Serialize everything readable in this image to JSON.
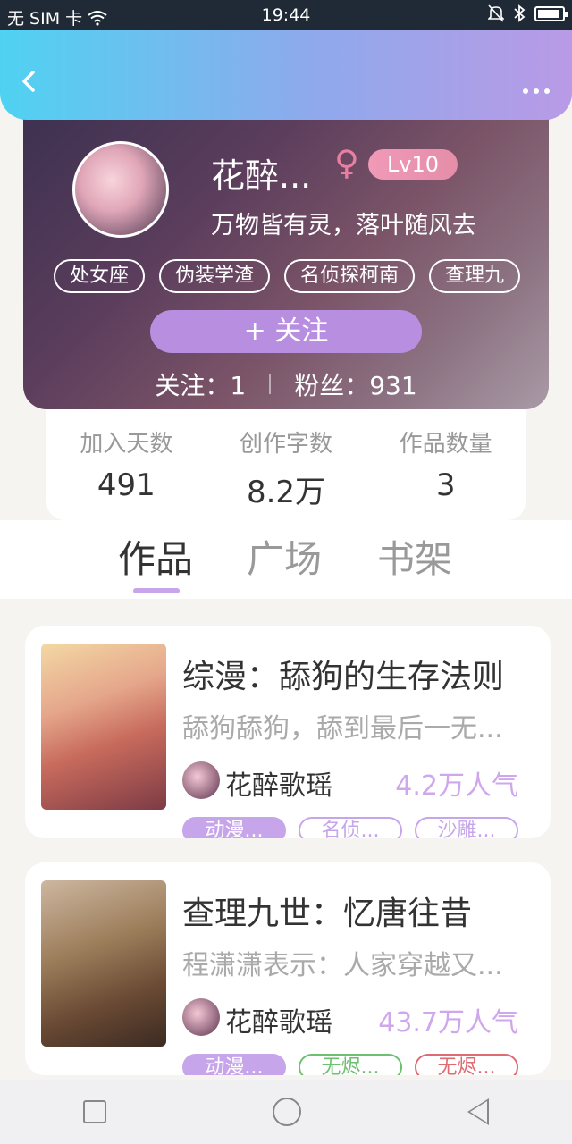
{
  "status_bar": {
    "carrier": "无 SIM 卡",
    "time": "19:44"
  },
  "header": {
    "back_icon": "chevron-left-icon",
    "more_icon": "more-dots-icon"
  },
  "profile": {
    "name": "花醉...",
    "gender_symbol": "♀",
    "level": "Lv10",
    "motto": "万物皆有灵，落叶随风去",
    "tags": [
      "处女座",
      "伪装学渣",
      "名侦探柯南",
      "查理九"
    ],
    "follow_button": "+  关注",
    "following_label": "关注：1",
    "fans_label": "粉丝：931"
  },
  "stats": [
    {
      "label": "加入天数",
      "value": "491"
    },
    {
      "label": "创作字数",
      "value": "8.2万"
    },
    {
      "label": "作品数量",
      "value": "3"
    }
  ],
  "tabs": [
    "作品",
    "广场",
    "书架"
  ],
  "active_tab": "作品",
  "books": [
    {
      "title": "综漫：舔狗的生存法则",
      "desc": "舔狗舔狗，舔到最后一无...",
      "author": "花醉歌瑶",
      "popularity": "4.2万人气",
      "tags": [
        "动漫...",
        "名侦...",
        "沙雕..."
      ]
    },
    {
      "title": "查理九世：忆唐往昔",
      "desc": "程潇潇表示：人家穿越又...",
      "author": "花醉歌瑶",
      "popularity": "43.7万人气",
      "tags": [
        "动漫...",
        "无烬...",
        "无烬..."
      ]
    }
  ],
  "colors": {
    "accent": "#c6a5ea",
    "popularity": "#cfa7ec",
    "tag_green": "#6cc070",
    "tag_red": "#e06a72"
  }
}
